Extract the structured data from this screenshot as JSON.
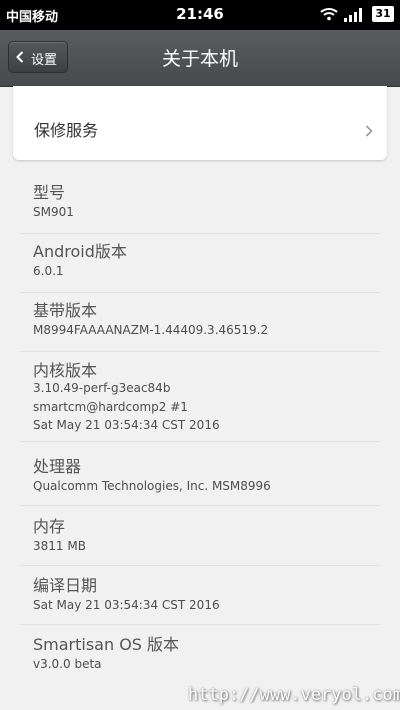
{
  "status_bar": {
    "carrier": "中国移动",
    "time": "21:46",
    "battery": "31",
    "icons": [
      "wifi-icon",
      "signal-icon",
      "battery-icon"
    ]
  },
  "header": {
    "back_label": "设置",
    "title": "关于本机"
  },
  "service": {
    "label": "保修服务"
  },
  "info": {
    "model": {
      "title": "型号",
      "value": "SM901"
    },
    "android": {
      "title": "Android版本",
      "value": "6.0.1"
    },
    "baseband": {
      "title": "基带版本",
      "value": "M8994FAAAANAZM-1.44409.3.46519.2"
    },
    "kernel": {
      "title": "内核版本",
      "line1": "3.10.49-perf-g3eac84b",
      "line2": "smartcm@hardcomp2 #1",
      "line3": "Sat May 21 03:54:34 CST 2016"
    },
    "processor": {
      "title": "处理器",
      "value": "Qualcomm Technologies, Inc. MSM8996"
    },
    "memory": {
      "title": "内存",
      "value": "3811 MB"
    },
    "build_date": {
      "title": "编译日期",
      "value": "Sat May 21 03:54:34 CST 2016"
    },
    "os": {
      "title": "Smartisan OS 版本",
      "value": "v3.0.0 beta"
    }
  },
  "watermark": "http://www.veryol.com",
  "colors": {
    "background": "#f1f1f1",
    "title_bar": "#4f5154",
    "text": "#555555"
  }
}
